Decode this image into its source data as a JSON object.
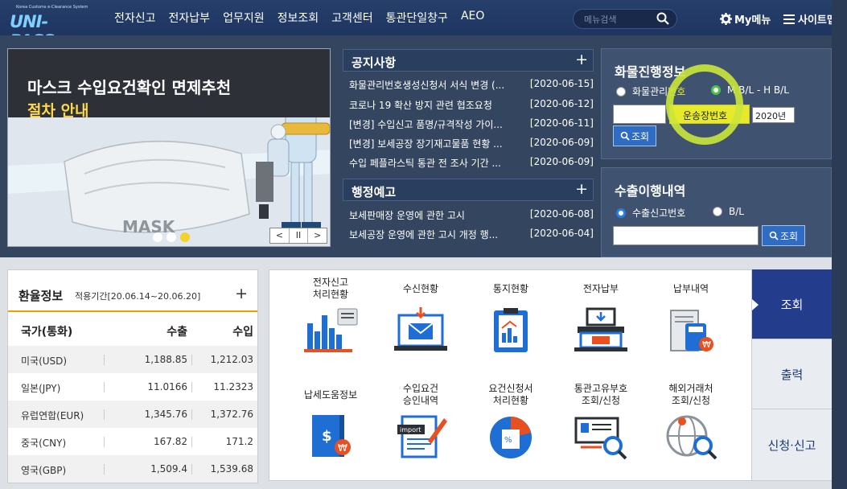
{
  "header": {
    "logo_small": "Korea Customs e-Clearance System",
    "logo": "UNI-PASS",
    "nav": [
      "전자신고",
      "전자납부",
      "업무지원",
      "정보조회",
      "고객센터",
      "통관단일창구",
      "AEO"
    ],
    "search_placeholder": "메뉴검색",
    "my_menu": "My메뉴",
    "sitemap": "사이트맵"
  },
  "banner": {
    "line1": "마스크 수입요건확인 면제추천",
    "line2": "절차 안내",
    "mask_text": "MASK",
    "controls": [
      "<",
      "II",
      ">"
    ],
    "slides": 3,
    "active_slide": 3
  },
  "notice": {
    "title": "공지사항",
    "plus": "+",
    "items": [
      {
        "title": "화물관리번호생성신청서 서식 변경 (...",
        "date": "[2020-06-15]"
      },
      {
        "title": "코로나 19 확산 방지 관련 협조요청",
        "date": "[2020-06-12]"
      },
      {
        "title": "[변경] 수입신고 품명/규격작성 가이...",
        "date": "[2020-06-11]"
      },
      {
        "title": "[변경] 보세공장 장기재고물품 현황 ...",
        "date": "[2020-06-09]"
      },
      {
        "title": "수입 페플라스틱 통관 전 조사 기간 ...",
        "date": "[2020-06-09]"
      }
    ]
  },
  "admin": {
    "title": "행정예고",
    "plus": "+",
    "items": [
      {
        "title": "보세판매장 운영에 관한 고시",
        "date": "[2020-06-08]"
      },
      {
        "title": "보세공장 운영에 관한 고시 개정 행...",
        "date": "[2020-06-04]"
      }
    ]
  },
  "cargo": {
    "title": "화물진행정보",
    "radio1_a": "화물관리",
    "radio1_b": "번호",
    "radio2": "M B/L - H B/L",
    "field2_label": "운송장번호",
    "year": "2020년",
    "search_btn": "조회"
  },
  "export": {
    "title": "수출이행내역",
    "radio1": "수출신고번호",
    "radio2": "B/L",
    "search_btn": "조회"
  },
  "rate": {
    "title": "환율정보",
    "period": "적용기간[20.06.14~20.06.20]",
    "plus": "+",
    "col1": "국가(통화)",
    "col2": "수출",
    "col3": "수입",
    "rows": [
      {
        "country": "미국(USD)",
        "export": "1,188.85",
        "import": "1,212.03"
      },
      {
        "country": "일본(JPY)",
        "export": "11.0166",
        "import": "11.2323"
      },
      {
        "country": "유럽연합(EUR)",
        "export": "1,345.76",
        "import": "1,372.76"
      },
      {
        "country": "중국(CNY)",
        "export": "167.82",
        "import": "171.2"
      },
      {
        "country": "영국(GBP)",
        "export": "1,509.4",
        "import": "1,539.68"
      }
    ]
  },
  "services": [
    {
      "l1": "전자신고",
      "l2": "처리현황"
    },
    {
      "l1": "수신현황",
      "l2": ""
    },
    {
      "l1": "통지현황",
      "l2": ""
    },
    {
      "l1": "전자납부",
      "l2": ""
    },
    {
      "l1": "납부내역",
      "l2": ""
    },
    {
      "l1": "납세도움정보",
      "l2": ""
    },
    {
      "l1": "수입요건",
      "l2": "승인내역"
    },
    {
      "l1": "요건신청서",
      "l2": "처리현황"
    },
    {
      "l1": "통관고유부호",
      "l2": "조회/신청"
    },
    {
      "l1": "해외거래처",
      "l2": "조회/신청"
    }
  ],
  "service_icon_texts": {
    "import": "import",
    "won": "₩",
    "dollar": "$",
    "percent": "%"
  },
  "tabs": [
    "조회",
    "출력",
    "신청·신고"
  ],
  "colors": {
    "header": "#1e3560",
    "accent": "#233d8c",
    "highlight": "#e6ea2a",
    "orange": "#f2a000"
  }
}
